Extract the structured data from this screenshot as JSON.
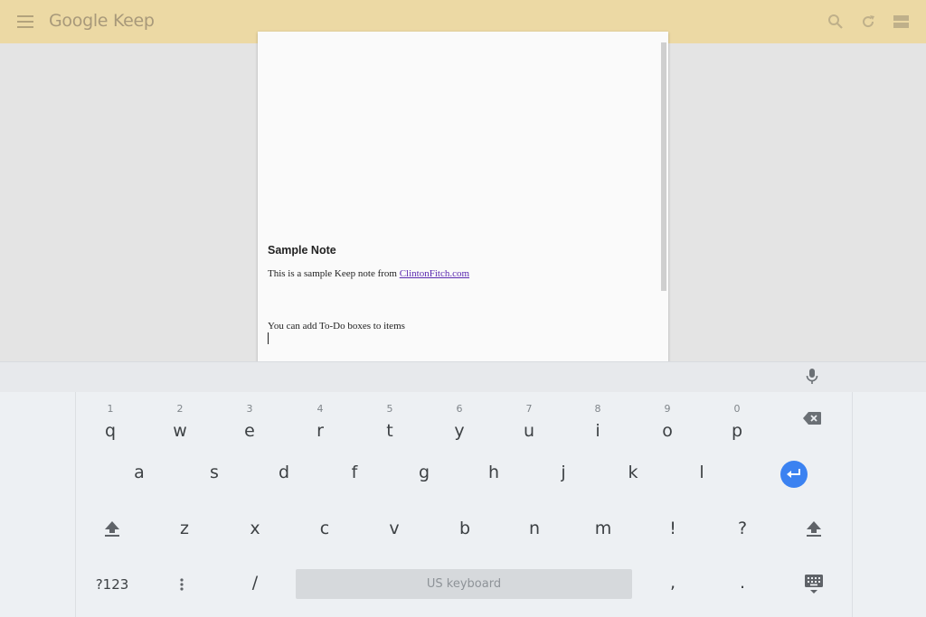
{
  "app": {
    "title": "Google Keep"
  },
  "colors": {
    "topbar": "#ecd9a4",
    "background": "#e4e4e4",
    "accent": "#3b82f1",
    "link": "#5b2ab0"
  },
  "icons": {
    "menu": "menu-icon",
    "search": "search-icon",
    "refresh": "refresh-icon",
    "view_toggle": "list-view-icon",
    "mic": "mic-icon",
    "backspace": "backspace-icon",
    "enter": "enter-icon",
    "shift": "shift-icon",
    "keyboard_hide": "keyboard-hide-icon",
    "more": "more-vert-icon"
  },
  "note": {
    "title": "Sample Note",
    "line1_prefix": "This is a sample Keep note from ",
    "line1_link": "ClintonFitch.com",
    "line2": "You can add To-Do boxes to items"
  },
  "keyboard": {
    "row1": [
      {
        "key": "q",
        "hint": "1"
      },
      {
        "key": "w",
        "hint": "2"
      },
      {
        "key": "e",
        "hint": "3"
      },
      {
        "key": "r",
        "hint": "4"
      },
      {
        "key": "t",
        "hint": "5"
      },
      {
        "key": "y",
        "hint": "6"
      },
      {
        "key": "u",
        "hint": "7"
      },
      {
        "key": "i",
        "hint": "8"
      },
      {
        "key": "o",
        "hint": "9"
      },
      {
        "key": "p",
        "hint": "0"
      }
    ],
    "row2": [
      "a",
      "s",
      "d",
      "f",
      "g",
      "h",
      "j",
      "k",
      "l"
    ],
    "row3": [
      "z",
      "x",
      "c",
      "v",
      "b",
      "n",
      "m",
      "!",
      "?"
    ],
    "symbols_label": "?123",
    "slash": "/",
    "space_label": "US keyboard",
    "comma": ",",
    "period": "."
  }
}
